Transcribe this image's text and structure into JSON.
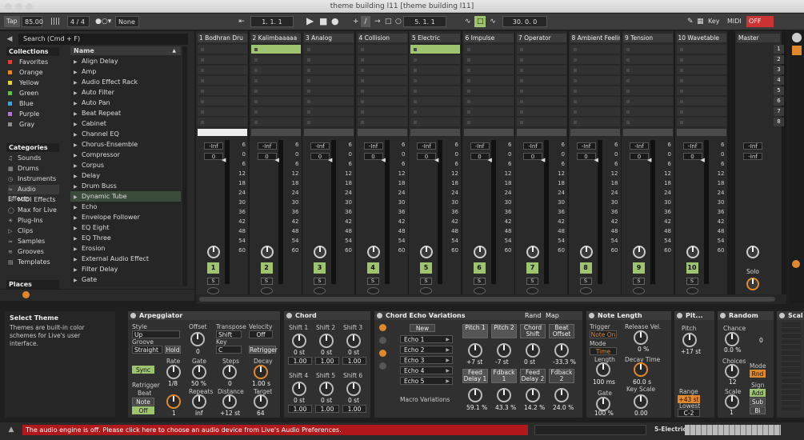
{
  "window": {
    "title": "theme building l11  [theme building l11]"
  },
  "control": {
    "tap": "Tap",
    "tempo": "85.00",
    "signature": "4 / 4",
    "metro": "1 Bar",
    "quantize": "None",
    "position": "1.  1.  1",
    "loop_start": "5.  1.  1",
    "loop_len": "30.  0.  0",
    "key": "Key",
    "midi": "MIDI",
    "cpu": "OFF"
  },
  "browser": {
    "search": "Search (Cmd + F)",
    "collections_title": "Collections",
    "collections": [
      {
        "label": "Favorites",
        "color": "#e0402f"
      },
      {
        "label": "Orange",
        "color": "#e8862a"
      },
      {
        "label": "Yellow",
        "color": "#e3d23a"
      },
      {
        "label": "Green",
        "color": "#64c04d"
      },
      {
        "label": "Blue",
        "color": "#3fa3d8"
      },
      {
        "label": "Purple",
        "color": "#b177d3"
      },
      {
        "label": "Gray",
        "color": "#8e8e8e"
      }
    ],
    "categories_title": "Categories",
    "categories": [
      {
        "label": "Sounds",
        "icon": "note-icon"
      },
      {
        "label": "Drums",
        "icon": "drum-icon"
      },
      {
        "label": "Instruments",
        "icon": "clock-icon"
      },
      {
        "label": "Audio Effects",
        "icon": "wave-icon"
      },
      {
        "label": "MIDI Effects",
        "icon": "midi-icon"
      },
      {
        "label": "Max for Live",
        "icon": "max-icon"
      },
      {
        "label": "Plug-Ins",
        "icon": "plug-icon"
      },
      {
        "label": "Clips",
        "icon": "clip-icon"
      },
      {
        "label": "Samples",
        "icon": "wave-icon"
      },
      {
        "label": "Grooves",
        "icon": "groove-icon"
      },
      {
        "label": "Templates",
        "icon": "template-icon"
      }
    ],
    "places_title": "Places",
    "name_header": "Name",
    "items": [
      "Align Delay",
      "Amp",
      "Audio Effect Rack",
      "Auto Filter",
      "Auto Pan",
      "Beat Repeat",
      "Cabinet",
      "Channel EQ",
      "Chorus-Ensemble",
      "Compressor",
      "Corpus",
      "Delay",
      "Drum Buss",
      "Dynamic Tube",
      "Echo",
      "Envelope Follower",
      "EQ Eight",
      "EQ Three",
      "Erosion",
      "External Audio Effect",
      "Filter Delay",
      "Gate"
    ],
    "selected_item": "Dynamic Tube"
  },
  "tracks": [
    {
      "name": "1 Bodhran Dru",
      "num": "1"
    },
    {
      "name": "2 Kalimbaaaaa",
      "num": "2"
    },
    {
      "name": "3 Analog",
      "num": "3"
    },
    {
      "name": "4 Collision",
      "num": "4"
    },
    {
      "name": "5 Electric",
      "num": "5"
    },
    {
      "name": "6 Impulse",
      "num": "6"
    },
    {
      "name": "7 Operator",
      "num": "7"
    },
    {
      "name": "8 Ambient Feelin",
      "num": "8"
    },
    {
      "name": "9 Tension",
      "num": "9"
    },
    {
      "name": "10 Wavetable",
      "num": "10"
    }
  ],
  "master": {
    "name": "Master",
    "solo": "Solo"
  },
  "mixer": {
    "inf": "-Inf",
    "zero": "0",
    "sbtn": "S",
    "scale": [
      "6",
      "0",
      "6",
      "12",
      "18",
      "24",
      "30",
      "36",
      "42",
      "48",
      "54",
      "60"
    ]
  },
  "scenes": [
    "1",
    "2",
    "3",
    "4",
    "5",
    "6",
    "7",
    "8"
  ],
  "info": {
    "title": "Select Theme",
    "text": "Themes are built-in color schemes for Live's user interface."
  },
  "arp": {
    "title": "Arpeggiator",
    "style_l": "Style",
    "style": "Up",
    "groove_l": "Groove",
    "groove": "Straight",
    "hold": "Hold",
    "offset_l": "Offset",
    "offset": "0",
    "transpose_l": "Transpose",
    "transpose": "Shift",
    "key_l": "Key",
    "key": "C",
    "velocity_l": "Velocity",
    "velocity": "Off",
    "retrigger": "Retrigger",
    "sync": "Sync",
    "rate_l": "Rate",
    "rate": "1/8",
    "gate_l": "Gate",
    "gate": "50 %",
    "steps_l": "Steps",
    "steps": "0",
    "decay_l": "Decay",
    "decay": "1.00 s",
    "retrig_l": "Retrigger",
    "retrig_beat": "Beat",
    "retrig_note": "Note",
    "retrig_off": "Off",
    "one": "1",
    "repeats_l": "Repeats",
    "repeats": "inf",
    "distance_l": "Distance",
    "distance": "+12 st",
    "target_l": "Target",
    "target": "64"
  },
  "chord": {
    "title": "Chord",
    "labels": [
      "Shift 1",
      "Shift 2",
      "Shift 3",
      "Shift 4",
      "Shift 5",
      "Shift 6"
    ],
    "st": "0 st",
    "vel": "1.00"
  },
  "echo": {
    "title": "Chord Echo Variations",
    "rand": "Rand",
    "map": "Map",
    "new": "New",
    "items": [
      "Echo 1",
      "Echo 2",
      "Echo 3",
      "Echo 4",
      "Echo 5"
    ],
    "macro": "Macro Variations",
    "p1": "Pitch 1",
    "p2": "Pitch 2",
    "cs": "Chord Shift",
    "bo": "Beat Offset",
    "p1v": "+7 st",
    "p2v": "-7 st",
    "csv": "0 st",
    "bov": "-33.3 %",
    "fd1": "Feed Delay 1",
    "fb1": "Fdback 1",
    "fd2": "Feed Delay 2",
    "fb2": "Fdback 2",
    "fd1v": "59.1 %",
    "fb1v": "43.3 %",
    "fd2v": "14.2 %",
    "fb2v": "24.0 %"
  },
  "notelen": {
    "title": "Note Length",
    "trigger_l": "Trigger",
    "trigger": "Note On",
    "release_l": "Release Vel.",
    "release": "0 %",
    "mode_l": "Mode",
    "mode": "Time",
    "length_l": "Length",
    "length": "100 ms",
    "decay_l": "Decay Time",
    "decay": "60.0 s",
    "gate_l": "Gate",
    "gate": "100 %",
    "keyscale_l": "Key Scale",
    "keyscale": "0.00"
  },
  "pitch": {
    "title": "Pit...",
    "pitch_l": "Pitch",
    "pitch": "+17 st",
    "range_l": "Range",
    "range": "+43 st",
    "lowest_l": "Lowest",
    "lowest": "C-2"
  },
  "random": {
    "title": "Random",
    "chance_l": "Chance",
    "chance": "0.0 %",
    "zero": "0",
    "choices_l": "Choices",
    "choices": "12",
    "mode_l": "Mode",
    "mode": "Rnd",
    "scale_l": "Scale",
    "scale": "1",
    "sign_l": "Sign",
    "add": "Add",
    "sub": "Sub",
    "bi": "Bi"
  },
  "scale": {
    "title": "Scal"
  },
  "status": {
    "message": "The audio engine is off. Please click here to choose an audio device from Live's Audio Preferences.",
    "track": "5-Electric"
  }
}
